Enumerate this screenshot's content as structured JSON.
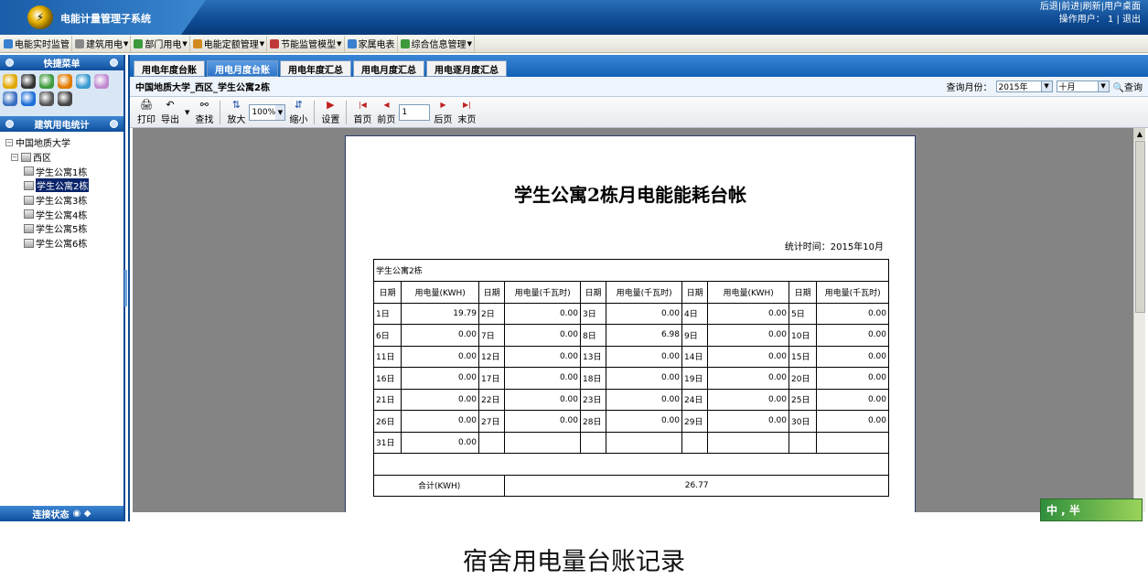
{
  "app": {
    "title": "电能计量管理子系统",
    "top_links": "后退|前进|刷新|用户桌面",
    "operator": "操作用户：  1 | 退出"
  },
  "menu": [
    {
      "label": "电能实时监管",
      "icon": "monitor-icon",
      "color": "#3a7fd0"
    },
    {
      "label": "建筑用电",
      "icon": "building-icon",
      "color": "#888888",
      "dropdown": true
    },
    {
      "label": "部门用电",
      "icon": "org-chart-icon",
      "color": "#3c9a3c",
      "dropdown": true
    },
    {
      "label": "电能定额管理",
      "icon": "quota-icon",
      "color": "#d08a20",
      "dropdown": true
    },
    {
      "label": "节能监管模型",
      "icon": "chart-icon",
      "color": "#c03a3a",
      "dropdown": true
    },
    {
      "label": "家属电表",
      "icon": "meter-icon",
      "color": "#3a7fd0"
    },
    {
      "label": "综合信息管理",
      "icon": "info-icon",
      "color": "#3c9a3c",
      "dropdown": true
    }
  ],
  "sidebar": {
    "quick_title": "快捷菜单",
    "quick_icons": [
      "#e0a800",
      "#333333",
      "#3c9a3c",
      "#e07b00",
      "#3a9ad0",
      "#c08ad0",
      "#3a6fc0",
      "#1e6fd8",
      "#555555",
      "#444444"
    ],
    "stats_title": "建筑用电统计",
    "tree": [
      {
        "label": "中国地质大学",
        "level": 0,
        "toggle": "−"
      },
      {
        "label": "西区",
        "level": 1,
        "toggle": "−"
      },
      {
        "label": "学生公寓1栋",
        "level": 2
      },
      {
        "label": "学生公寓2栋",
        "level": 2,
        "selected": true
      },
      {
        "label": "学生公寓3栋",
        "level": 2
      },
      {
        "label": "学生公寓4栋",
        "level": 2
      },
      {
        "label": "学生公寓5栋",
        "level": 2
      },
      {
        "label": "学生公寓6栋",
        "level": 2
      }
    ],
    "footer": "连接状态"
  },
  "tabs": [
    {
      "label": "用电年度台账",
      "active": false
    },
    {
      "label": "用电月度台账",
      "active": true
    },
    {
      "label": "用电年度汇总",
      "active": false
    },
    {
      "label": "用电月度汇总",
      "active": false
    },
    {
      "label": "用电逐月度汇总",
      "active": false
    }
  ],
  "breadcrumb": "中国地质大学_西区_学生公寓2栋",
  "query": {
    "label": "查询月份：",
    "year": "2015年",
    "month": "十月",
    "button": "查询"
  },
  "toolbar": {
    "print": "打印",
    "export": "导出",
    "find": "查找",
    "zoom_in": "放大",
    "zoom_value": "100%",
    "zoom_out": "缩小",
    "settings": "设置",
    "first": "首页",
    "prev": "前页",
    "page": "1",
    "next": "后页",
    "last": "末页"
  },
  "report": {
    "title": "学生公寓2栋月电能能耗台帐",
    "stat_time": "统计时间：2015年10月",
    "building": "学生公寓2栋",
    "headers": [
      "日期",
      "用电量(KWH)",
      "日期",
      "用电量(千瓦时)",
      "日期",
      "用电量(千瓦时)",
      "日期",
      "用电量(KWH)",
      "日期",
      "用电量(千瓦时)"
    ],
    "rows": [
      [
        "1日",
        "19.79",
        "2日",
        "0.00",
        "3日",
        "0.00",
        "4日",
        "0.00",
        "5日",
        "0.00"
      ],
      [
        "6日",
        "0.00",
        "7日",
        "0.00",
        "8日",
        "6.98",
        "9日",
        "0.00",
        "10日",
        "0.00"
      ],
      [
        "11日",
        "0.00",
        "12日",
        "0.00",
        "13日",
        "0.00",
        "14日",
        "0.00",
        "15日",
        "0.00"
      ],
      [
        "16日",
        "0.00",
        "17日",
        "0.00",
        "18日",
        "0.00",
        "19日",
        "0.00",
        "20日",
        "0.00"
      ],
      [
        "21日",
        "0.00",
        "22日",
        "0.00",
        "23日",
        "0.00",
        "24日",
        "0.00",
        "25日",
        "0.00"
      ],
      [
        "26日",
        "0.00",
        "27日",
        "0.00",
        "28日",
        "0.00",
        "29日",
        "0.00",
        "30日",
        "0.00"
      ],
      [
        "31日",
        "0.00",
        "",
        "",
        "",
        "",
        "",
        "",
        "",
        ""
      ]
    ],
    "total_label": "合计(KWH)",
    "total_value": "26.77"
  },
  "ime": "中 , 半",
  "caption": "宿舍用电量台账记录"
}
